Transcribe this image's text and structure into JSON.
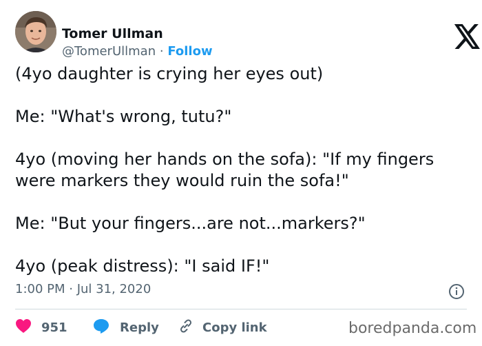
{
  "author": {
    "name": "Tomer Ullman",
    "handle": "@TomerUllman",
    "separator": "·",
    "follow_label": "Follow"
  },
  "tweet": {
    "lines": [
      "(4yo daughter is crying her eyes out)",
      "Me: \"What's wrong, tutu?\"",
      "4yo (moving her hands on the sofa): \"If my fingers were markers they would ruin the sofa!\"",
      "Me: \"But your fingers...are not...markers?\"",
      "4yo (peak distress): \"I said IF!\""
    ],
    "timestamp": "1:00 PM · Jul 31, 2020"
  },
  "actions": {
    "like_count": "951",
    "reply_label": "Reply",
    "copy_label": "Copy link"
  },
  "watermark": "boredpanda.com",
  "colors": {
    "accent": "#1d9bf0",
    "like": "#f91880",
    "muted": "#536471"
  },
  "icons": [
    "x-logo-icon",
    "info-icon",
    "heart-icon",
    "reply-bubble-icon",
    "link-icon"
  ]
}
